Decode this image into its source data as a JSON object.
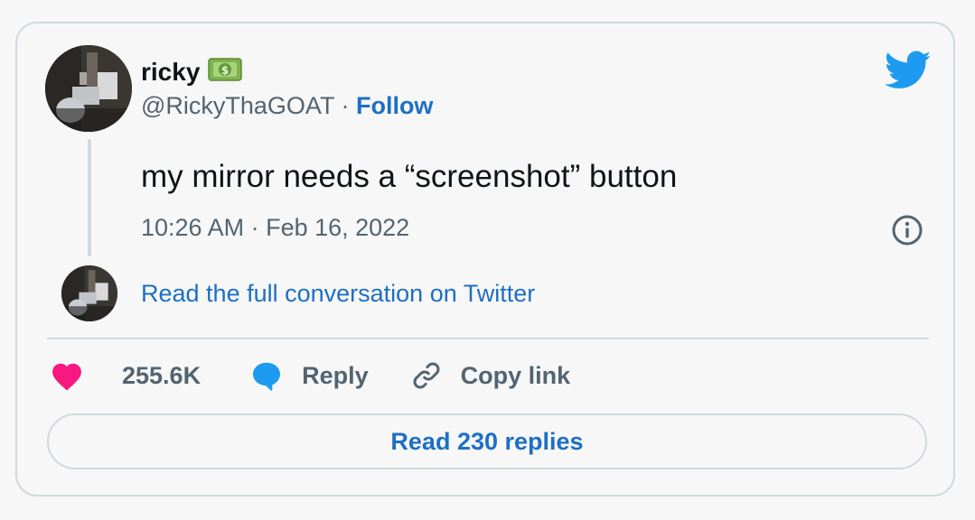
{
  "tweet": {
    "author_name": "ricky",
    "author_emoji": "money-with-wings-emoji",
    "handle": "@RickyThaGOAT",
    "separator": " · ",
    "follow_label": "Follow",
    "text": "my mirror needs a “screenshot” button",
    "timestamp": "10:26 AM · Feb 16, 2022",
    "read_conversation": "Read the full conversation on Twitter",
    "like_count": "255.6K",
    "reply_label": "Reply",
    "copy_link_label": "Copy link",
    "read_replies_label": "Read 230 replies"
  },
  "icons": {
    "brand": "twitter-bird-icon",
    "info": "info-icon",
    "like": "heart-icon",
    "reply": "speech-bubble-icon",
    "copy": "link-icon"
  },
  "colors": {
    "link_blue": "#1d70c4",
    "twitter_blue": "#1d9bf0",
    "heart_pink": "#f91880",
    "secondary_text": "#536471",
    "border": "#cfd9de"
  }
}
